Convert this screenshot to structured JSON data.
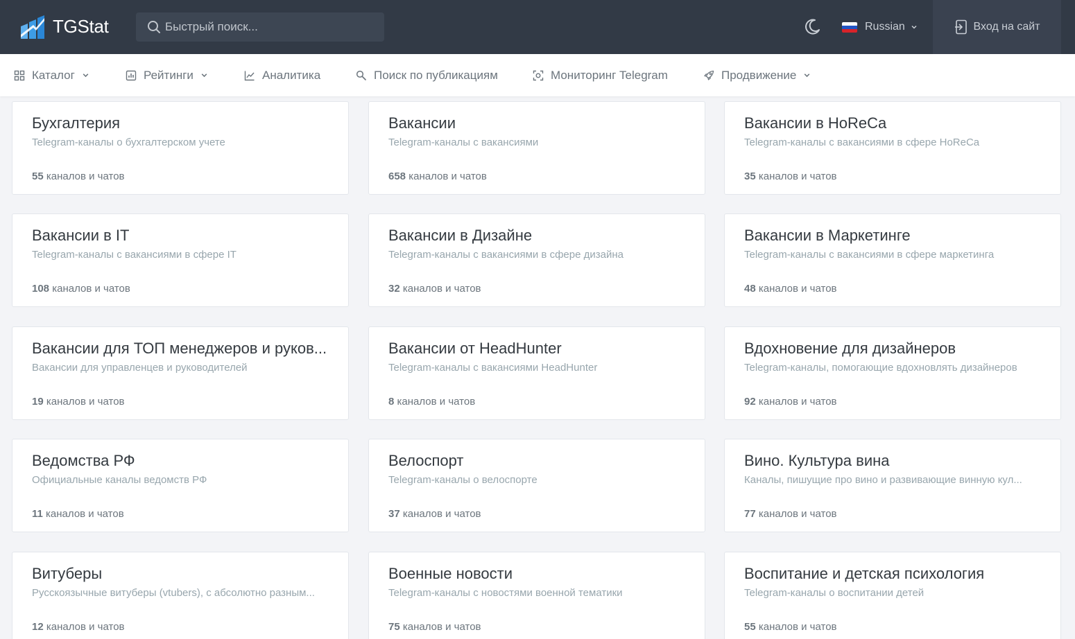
{
  "header": {
    "logo_text": "TGStat",
    "search_placeholder": "Быстрый поиск...",
    "language": "Russian",
    "login_label": "Вход на сайт"
  },
  "nav": {
    "items": [
      {
        "label": "Каталог",
        "icon": "grid-icon",
        "dropdown": true
      },
      {
        "label": "Рейтинги",
        "icon": "chart-box-icon",
        "dropdown": true
      },
      {
        "label": "Аналитика",
        "icon": "line-chart-icon",
        "dropdown": false
      },
      {
        "label": "Поиск по публикациям",
        "icon": "search-icon",
        "dropdown": false
      },
      {
        "label": "Мониторинг Telegram",
        "icon": "scan-icon",
        "dropdown": false
      },
      {
        "label": "Продвижение",
        "icon": "rocket-icon",
        "dropdown": true
      }
    ]
  },
  "count_suffix": "каналов и чатов",
  "cards": [
    {
      "title": "Бухгалтерия",
      "desc": "Telegram-каналы о бухгалтерском учете",
      "count": "55"
    },
    {
      "title": "Вакансии",
      "desc": "Telegram-каналы с вакансиями",
      "count": "658"
    },
    {
      "title": "Вакансии в HoReCa",
      "desc": "Telegram-каналы с вакансиями в сфере HoReCa",
      "count": "35"
    },
    {
      "title": "Вакансии в IT",
      "desc": "Telegram-каналы с вакансиями в сфере IT",
      "count": "108"
    },
    {
      "title": "Вакансии в Дизайне",
      "desc": "Telegram-каналы с вакансиями в сфере дизайна",
      "count": "32"
    },
    {
      "title": "Вакансии в Маркетинге",
      "desc": "Telegram-каналы с вакансиями в сфере маркетинга",
      "count": "48"
    },
    {
      "title": "Вакансии для ТОП менеджеров и руков...",
      "desc": "Вакансии для управленцев и руководителей",
      "count": "19"
    },
    {
      "title": "Вакансии от HeadHunter",
      "desc": "Telegram-каналы с вакансиями HeadHunter",
      "count": "8"
    },
    {
      "title": "Вдохновение для дизайнеров",
      "desc": "Telegram-каналы, помогающие вдохновлять дизайнеров",
      "count": "92"
    },
    {
      "title": "Ведомства РФ",
      "desc": "Официальные каналы ведомств РФ",
      "count": "11"
    },
    {
      "title": "Велоспорт",
      "desc": "Telegram-каналы о велоспорте",
      "count": "37"
    },
    {
      "title": "Вино. Культура вина",
      "desc": "Каналы, пишущие про вино и развивающие винную кул...",
      "count": "77"
    },
    {
      "title": "Витуберы",
      "desc": "Русскоязычные витуберы (vtubers), с абсолютно разным...",
      "count": "12"
    },
    {
      "title": "Военные новости",
      "desc": "Telegram-каналы с новостями военной тематики",
      "count": "75"
    },
    {
      "title": "Воспитание и детская психология",
      "desc": "Telegram-каналы о воспитании детей",
      "count": "55"
    }
  ],
  "colors": {
    "header_bg": "#323a46",
    "page_bg": "#f3f4f7",
    "logo_blue": "#3d9ce6"
  }
}
